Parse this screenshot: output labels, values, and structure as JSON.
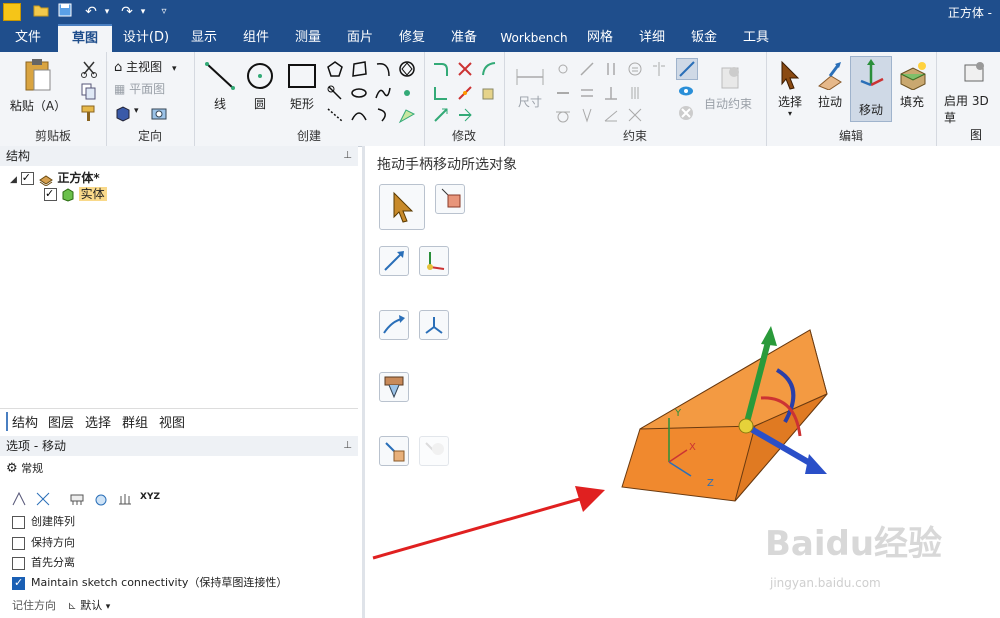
{
  "window": {
    "title": "正方体 -"
  },
  "quick_access": [
    "folder-open-icon",
    "save-icon",
    "undo-icon",
    "redo-icon",
    "customize-icon"
  ],
  "menu_tabs": [
    "文件",
    "草图",
    "设计(D)",
    "显示",
    "组件",
    "测量",
    "面片",
    "修复",
    "准备",
    "Workbench",
    "网格",
    "详细",
    "钣金",
    "工具"
  ],
  "ribbon": {
    "clipboard": {
      "label": "剪贴板",
      "paste": "粘贴（A）"
    },
    "orient": {
      "label": "定向",
      "home_view": "主视图",
      "plane_view": "平面图"
    },
    "create": {
      "label": "创建",
      "line": "线",
      "circle": "圆",
      "rect": "矩形"
    },
    "modify": {
      "label": "修改"
    },
    "constraint": {
      "label": "约束",
      "dimension": "尺寸",
      "auto_constraint": "自动约束"
    },
    "edit": {
      "label": "编辑",
      "select": "选择",
      "pull": "拉动",
      "move": "移动",
      "fill": "填充"
    },
    "extra": {
      "enable": "启用",
      "three_d": "3D 草",
      "figure": "图"
    }
  },
  "structure_panel": {
    "title": "结构",
    "root": "正方体*",
    "child": "实体"
  },
  "panel_tabs": [
    "结构",
    "图层",
    "选择",
    "群组",
    "视图"
  ],
  "options_panel": {
    "title": "选项 - 移动",
    "section": "常规",
    "items": [
      {
        "label": "创建阵列",
        "checked": false
      },
      {
        "label": "保持方向",
        "checked": false
      },
      {
        "label": "首先分离",
        "checked": false
      },
      {
        "label": "Maintain sketch connectivity（保持草图连接性）",
        "checked": true
      }
    ],
    "remember_dir": "记住方向",
    "default": "默认"
  },
  "viewport": {
    "hint": "拖动手柄移动所选对象",
    "axis_labels": {
      "x": "X",
      "y": "Y",
      "z": "Z"
    },
    "watermark": "Baidu经验",
    "watermark_url": "jingyan.baidu.com"
  },
  "colors": {
    "accent": "#1f4e8c",
    "solid": "#f0892e",
    "arrow": "#e02020"
  }
}
